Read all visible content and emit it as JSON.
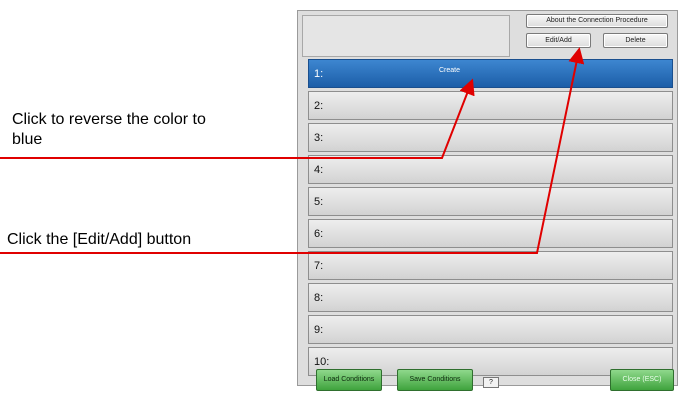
{
  "annotations": {
    "reverse_color": "Click to reverse the color to blue",
    "edit_add": "Click the [Edit/Add] button"
  },
  "toolbar": {
    "about_label": "About the Connection Procedure",
    "edit_add_label": "Edit/Add",
    "delete_label": "Delete"
  },
  "list": {
    "rows": [
      {
        "number": "1:",
        "name": "Create",
        "selected": true
      },
      {
        "number": "2:",
        "name": ""
      },
      {
        "number": "3:",
        "name": ""
      },
      {
        "number": "4:",
        "name": ""
      },
      {
        "number": "5:",
        "name": ""
      },
      {
        "number": "6:",
        "name": ""
      },
      {
        "number": "7:",
        "name": ""
      },
      {
        "number": "8:",
        "name": ""
      },
      {
        "number": "9:",
        "name": ""
      },
      {
        "number": "10:",
        "name": ""
      }
    ]
  },
  "footer": {
    "load_label": "Load Conditions",
    "save_label": "Save Conditions",
    "help_label": "?",
    "close_label": "Close (ESC)"
  },
  "colors": {
    "selected_row": "#2a6fbe",
    "annotation_line": "#e00000",
    "green_button": "#5cbc59"
  }
}
